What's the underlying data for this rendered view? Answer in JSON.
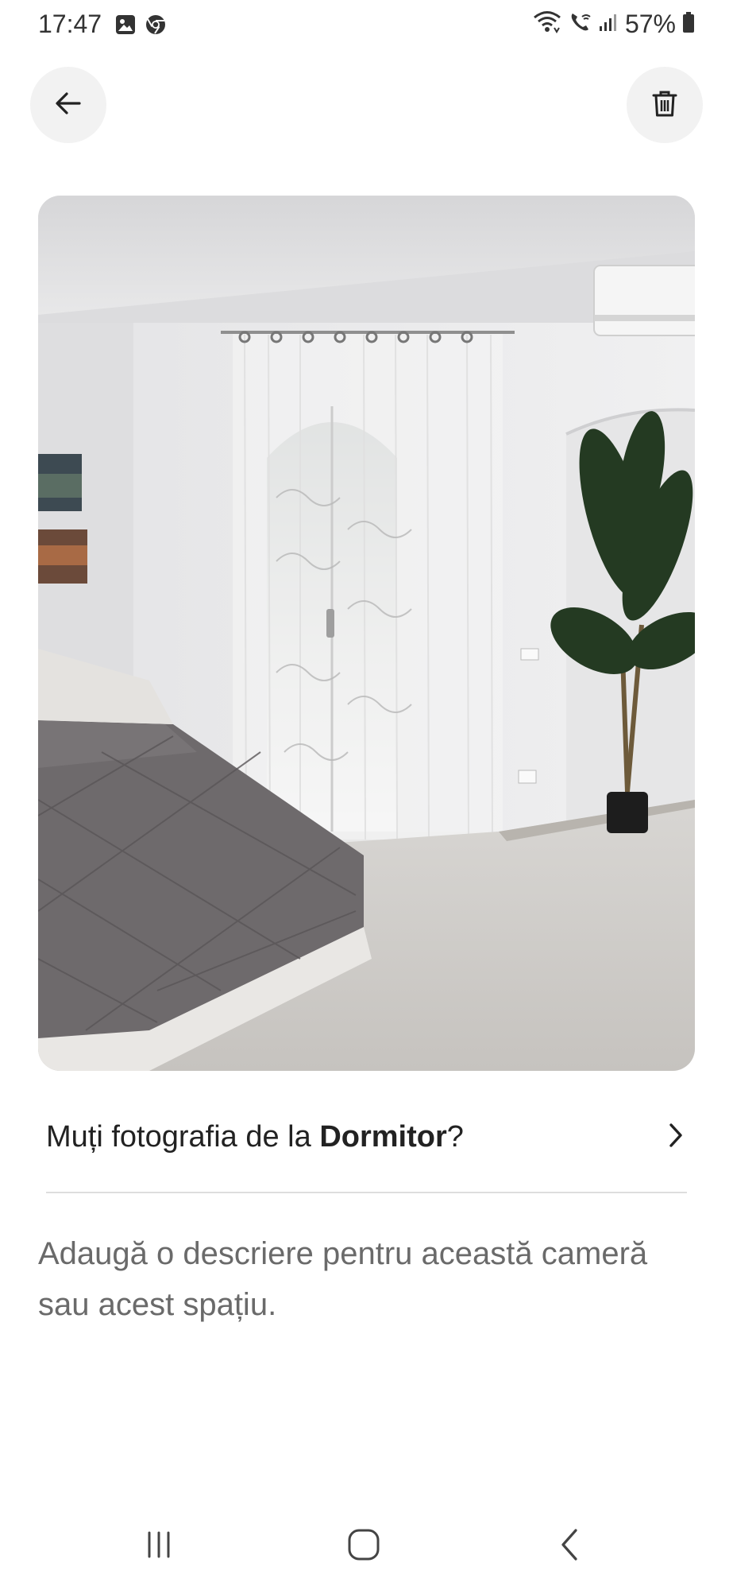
{
  "status_bar": {
    "time": "17:47",
    "battery_percent": "57%",
    "icons": [
      "gallery-icon",
      "chrome-icon",
      "wifi-icon",
      "wifi-call-icon",
      "signal-icon",
      "battery-icon"
    ]
  },
  "toolbar": {
    "back_icon": "arrow-left-icon",
    "delete_icon": "trash-icon"
  },
  "photo": {
    "subject": "bedroom"
  },
  "move_row": {
    "prefix": "Muți fotografia de la ",
    "room": "Dormitor",
    "suffix": "?",
    "chevron_icon": "chevron-right-icon"
  },
  "description": {
    "placeholder": "Adaugă o descriere pentru această cameră sau acest spațiu."
  },
  "nav_bar": {
    "icons": [
      "recent-apps-icon",
      "home-icon",
      "back-icon"
    ]
  },
  "colors": {
    "text_primary": "#222222",
    "text_secondary": "#6a6a6a",
    "button_bg": "#f2f2f2",
    "divider": "#dddddd"
  }
}
